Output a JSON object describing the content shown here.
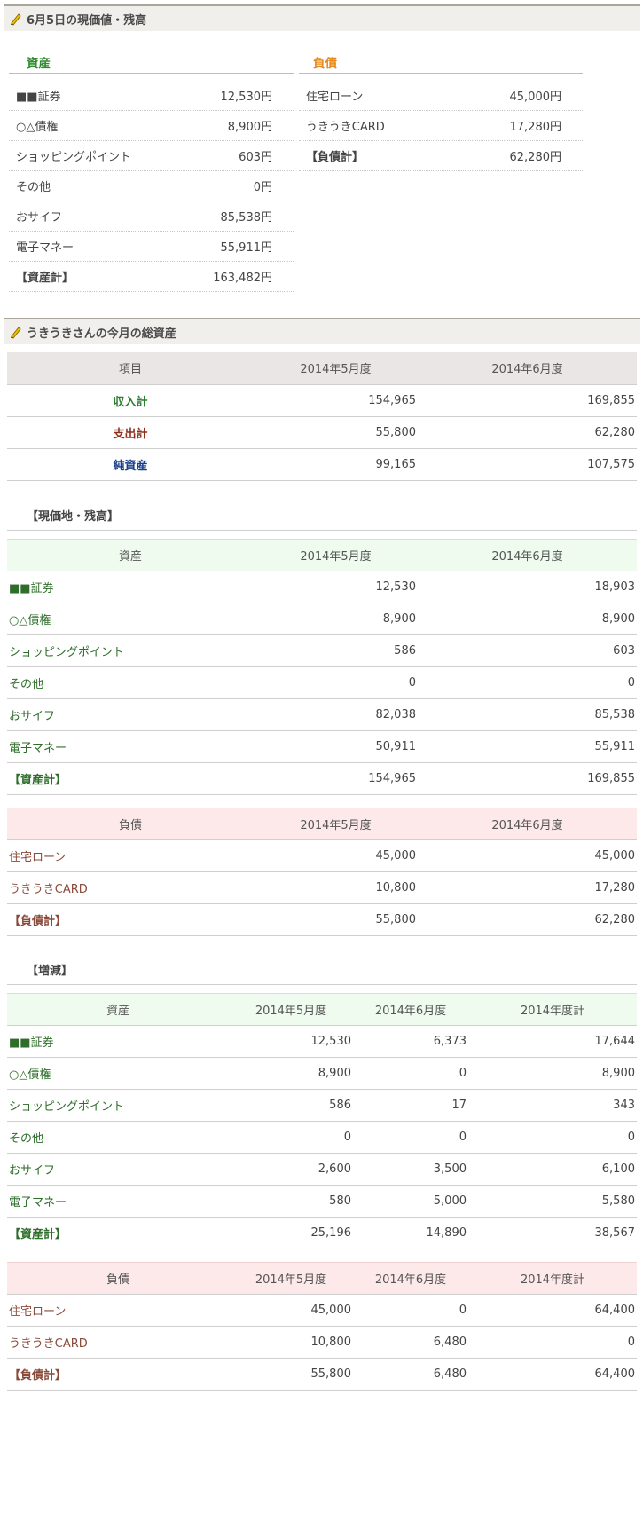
{
  "balance_section": {
    "title": "6月5日の現価値・残高",
    "assets_title": "資産",
    "liabilities_title": "負債",
    "assets": [
      {
        "label": "■■証券",
        "value": "12,530円"
      },
      {
        "label": "○△債権",
        "value": "8,900円"
      },
      {
        "label": "ショッピングポイント",
        "value": "603円"
      },
      {
        "label": "その他",
        "value": "0円"
      },
      {
        "label": "おサイフ",
        "value": "85,538円"
      },
      {
        "label": "電子マネー",
        "value": "55,911円"
      },
      {
        "label": "【資産計】",
        "value": "163,482円"
      }
    ],
    "liabilities": [
      {
        "label": "住宅ローン",
        "value": "45,000円"
      },
      {
        "label": "うきうきCARD",
        "value": "17,280円"
      },
      {
        "label": "【負債計】",
        "value": "62,280円"
      }
    ],
    "colors": {
      "assets_title": "#2e8b2e",
      "liabilities_title": "#e8891a"
    }
  },
  "monthly_section": {
    "title": "うきうきさんの今月の総資産",
    "summary": {
      "headers": [
        "項目",
        "2014年5月度",
        "2014年6月度"
      ],
      "rows": [
        {
          "label": "収入計",
          "may": "154,965",
          "jun": "169,855",
          "color": "#2e7d32"
        },
        {
          "label": "支出計",
          "may": "55,800",
          "jun": "62,280",
          "color": "#8b2e1a"
        },
        {
          "label": "純資産",
          "may": "99,165",
          "jun": "107,575",
          "color": "#1a3f8b"
        }
      ]
    },
    "current_values": {
      "heading": "【現価地・残高】",
      "assets_headers": [
        "資産",
        "2014年5月度",
        "2014年6月度"
      ],
      "assets_rows": [
        {
          "label": "■■証券",
          "may": "12,530",
          "jun": "18,903"
        },
        {
          "label": "○△債権",
          "may": "8,900",
          "jun": "8,900"
        },
        {
          "label": "ショッピングポイント",
          "may": "586",
          "jun": "603"
        },
        {
          "label": "その他",
          "may": "0",
          "jun": "0"
        },
        {
          "label": "おサイフ",
          "may": "82,038",
          "jun": "85,538"
        },
        {
          "label": "電子マネー",
          "may": "50,911",
          "jun": "55,911"
        },
        {
          "label": "【資産計】",
          "may": "154,965",
          "jun": "169,855"
        }
      ],
      "liabilities_headers": [
        "負債",
        "2014年5月度",
        "2014年6月度"
      ],
      "liabilities_rows": [
        {
          "label": "住宅ローン",
          "may": "45,000",
          "jun": "45,000"
        },
        {
          "label": "うきうきCARD",
          "may": "10,800",
          "jun": "17,280"
        },
        {
          "label": "【負債計】",
          "may": "55,800",
          "jun": "62,280"
        }
      ]
    },
    "changes": {
      "heading": "【増減】",
      "assets_headers": [
        "資産",
        "2014年5月度",
        "2014年6月度",
        "2014年度計"
      ],
      "assets_rows": [
        {
          "label": "■■証券",
          "may": "12,530",
          "jun": "6,373",
          "total": "17,644"
        },
        {
          "label": "○△債権",
          "may": "8,900",
          "jun": "0",
          "total": "8,900"
        },
        {
          "label": "ショッピングポイント",
          "may": "586",
          "jun": "17",
          "total": "343"
        },
        {
          "label": "その他",
          "may": "0",
          "jun": "0",
          "total": "0"
        },
        {
          "label": "おサイフ",
          "may": "2,600",
          "jun": "3,500",
          "total": "6,100"
        },
        {
          "label": "電子マネー",
          "may": "580",
          "jun": "5,000",
          "total": "5,580"
        },
        {
          "label": "【資産計】",
          "may": "25,196",
          "jun": "14,890",
          "total": "38,567"
        }
      ],
      "liabilities_headers": [
        "負債",
        "2014年5月度",
        "2014年6月度",
        "2014年度計"
      ],
      "liabilities_rows": [
        {
          "label": "住宅ローン",
          "may": "45,000",
          "jun": "0",
          "total": "64,400"
        },
        {
          "label": "うきうきCARD",
          "may": "10,800",
          "jun": "6,480",
          "total": "0"
        },
        {
          "label": "【負債計】",
          "may": "55,800",
          "jun": "6,480",
          "total": "64,400"
        }
      ]
    }
  }
}
